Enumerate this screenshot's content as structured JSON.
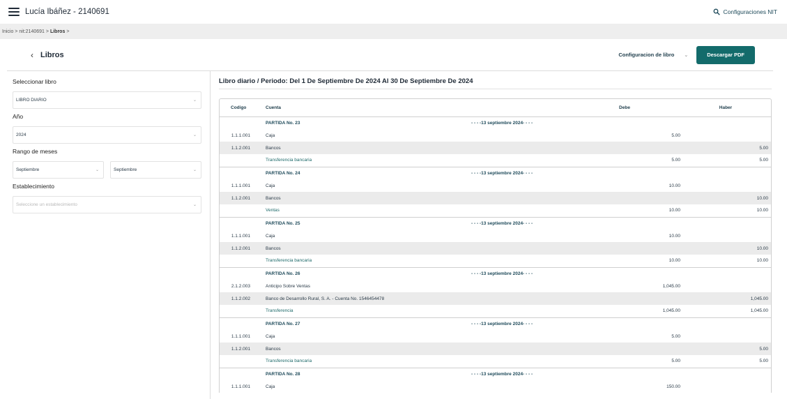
{
  "topbar": {
    "user": "Lucía Ibáñez - 2140691",
    "config_nit": "Configuraciones NIT"
  },
  "breadcrumb": {
    "path": "Inicio > nit:2140691 >",
    "current": "Libros",
    "tail": ">"
  },
  "header": {
    "title": "Libros",
    "config_libro": "Configuracion de libro",
    "download_pdf": "Descargar PDF"
  },
  "sidebar": {
    "libro_label": "Seleccionar libro",
    "libro_value": "LIBRO DIARIO",
    "anio_label": "Año",
    "anio_value": "2024",
    "rango_label": "Rango de meses",
    "mes_desde": "Septiembre",
    "mes_hasta": "Septiembre",
    "estab_label": "Establecimiento",
    "estab_placeholder": "Seleccione un establecimiento"
  },
  "main": {
    "title": "Libro diario / Periodo: Del 1 De Septiembre De 2024 Al 30 De Septiembre De 2024",
    "columns": {
      "codigo": "Codigo",
      "cuenta": "Cuenta",
      "debe": "Debe",
      "haber": "Haber"
    },
    "rows": [
      {
        "type": "partida",
        "cuenta": "PARTIDA No. 23",
        "fecha": "- - - -13 septiembre 2024- - - -"
      },
      {
        "type": "line",
        "codigo": "1.1.1.001",
        "cuenta": "Caja",
        "debe": "5.00",
        "haber": ""
      },
      {
        "type": "line",
        "shade": true,
        "codigo": "1.1.2.001",
        "cuenta": "Bancos",
        "debe": "",
        "haber": "5.00"
      },
      {
        "type": "desc",
        "cuenta": "Transferencia bancaria",
        "debe": "5.00",
        "haber": "5.00"
      },
      {
        "type": "partida",
        "cuenta": "PARTIDA No. 24",
        "fecha": "- - - -13 septiembre 2024- - - -"
      },
      {
        "type": "line",
        "codigo": "1.1.1.001",
        "cuenta": "Caja",
        "debe": "10.00",
        "haber": ""
      },
      {
        "type": "line",
        "shade": true,
        "codigo": "1.1.2.001",
        "cuenta": "Bancos",
        "debe": "",
        "haber": "10.00"
      },
      {
        "type": "desc",
        "cuenta": "Ventas",
        "debe": "10.00",
        "haber": "10.00"
      },
      {
        "type": "partida",
        "cuenta": "PARTIDA No. 25",
        "fecha": "- - - -13 septiembre 2024- - - -"
      },
      {
        "type": "line",
        "codigo": "1.1.1.001",
        "cuenta": "Caja",
        "debe": "10.00",
        "haber": ""
      },
      {
        "type": "line",
        "shade": true,
        "codigo": "1.1.2.001",
        "cuenta": "Bancos",
        "debe": "",
        "haber": "10.00"
      },
      {
        "type": "desc",
        "cuenta": "Transferencia bancaria",
        "debe": "10.00",
        "haber": "10.00"
      },
      {
        "type": "partida",
        "cuenta": "PARTIDA No. 26",
        "fecha": "- - - -13 septiembre 2024- - - -"
      },
      {
        "type": "line",
        "codigo": "2.1.2.003",
        "cuenta": "Anticipo Sobre Ventas",
        "debe": "1,045.00",
        "haber": ""
      },
      {
        "type": "line",
        "shade": true,
        "codigo": "1.1.2.002",
        "cuenta": "Banco de Desarrollo Rural, S. A. - Cuenta No. 1546454478",
        "debe": "",
        "haber": "1,045.00"
      },
      {
        "type": "desc",
        "cuenta": "Transferencia",
        "debe": "1,045.00",
        "haber": "1,045.00"
      },
      {
        "type": "partida",
        "cuenta": "PARTIDA No. 27",
        "fecha": "- - - -13 septiembre 2024- - - -"
      },
      {
        "type": "line",
        "codigo": "1.1.1.001",
        "cuenta": "Caja",
        "debe": "5.00",
        "haber": ""
      },
      {
        "type": "line",
        "shade": true,
        "codigo": "1.1.2.001",
        "cuenta": "Bancos",
        "debe": "",
        "haber": "5.00"
      },
      {
        "type": "desc",
        "cuenta": "Transferencia bancaria",
        "debe": "5.00",
        "haber": "5.00"
      },
      {
        "type": "partida",
        "cuenta": "PARTIDA No. 28",
        "fecha": "- - - -13 septiembre 2024- - - -"
      },
      {
        "type": "line",
        "codigo": "1.1.1.001",
        "cuenta": "Caja",
        "debe": "150.00",
        "haber": ""
      }
    ]
  },
  "colors": {
    "accent": "#136b6b",
    "text_dark": "#1f2a36",
    "shade": "#ebebeb"
  }
}
